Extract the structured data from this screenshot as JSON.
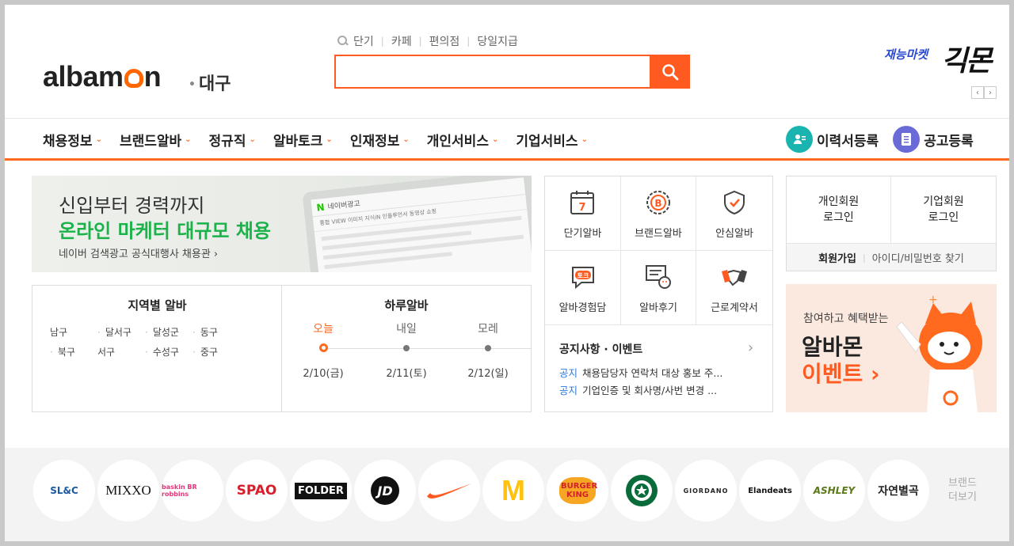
{
  "header": {
    "logo_text_a": "alba",
    "logo_text_b": "n",
    "region": "대구",
    "quick_links": [
      "단기",
      "카페",
      "편의점",
      "당일지급"
    ],
    "search_placeholder": "",
    "partner_small": "재능마켓",
    "partner_big": "긱몬"
  },
  "nav": {
    "items": [
      "채용정보",
      "브랜드알바",
      "정규직",
      "알바토크",
      "인재정보",
      "개인서비스",
      "기업서비스"
    ],
    "resume_label": "이력서등록",
    "post_label": "공고등록"
  },
  "banner": {
    "line1": "신입부터 경력까지",
    "line2": "온라인 마케터 대규모 채용",
    "line3": "네이버 검색광고 공식대행사 채용관 ›",
    "tablet_brand": "N",
    "tablet_title": "네이버광고",
    "tablet_menu": "통합   VIEW   이미지   지식iN   인플루언서   동영상   쇼핑"
  },
  "region_box": {
    "title": "지역별 알바",
    "regions": [
      "남구",
      "달서구",
      "달성군",
      "동구",
      "북구",
      "서구",
      "수성구",
      "중구"
    ]
  },
  "daily_box": {
    "title": "하루알바",
    "days": [
      {
        "label": "오늘",
        "date": "2/10(금)"
      },
      {
        "label": "내일",
        "date": "2/11(토)"
      },
      {
        "label": "모레",
        "date": "2/12(일)"
      }
    ]
  },
  "services": {
    "items": [
      "단기알바",
      "브랜드알바",
      "안심알바",
      "알바경험담",
      "알바후기",
      "근로계약서"
    ],
    "calendar_num": "7",
    "brand_mark": "B",
    "talk_mark": "토크"
  },
  "notice": {
    "title": "공지사항 · 이벤트",
    "rows": [
      {
        "tag": "공지",
        "text": "채용담당자 연락처 대상 홍보 주..."
      },
      {
        "tag": "공지",
        "text": "기업인증 및 회사명/사번 변경 ..."
      }
    ]
  },
  "login": {
    "personal": "개인회원\n로그인",
    "company": "기업회원\n로그인",
    "signup": "회원가입",
    "find": "아이디/비밀번호 찾기"
  },
  "event": {
    "line1": "참여하고 혜택받는",
    "line2": "알바몬",
    "line3": "이벤트 ›"
  },
  "brands": {
    "items": [
      "SL&C",
      "MIXXO",
      "baskin BR robbins",
      "SPAO",
      "FOLDER",
      "JD",
      "",
      "M",
      "BURGER KING",
      "",
      "GIORDANO",
      "Elandeats",
      "ASHLEY",
      "자연별곡"
    ],
    "more": "브랜드\n더보기",
    "colors": {
      "accent": "#ff5a1f",
      "teal": "#1ab4b0",
      "purple": "#6b6bd8"
    }
  }
}
